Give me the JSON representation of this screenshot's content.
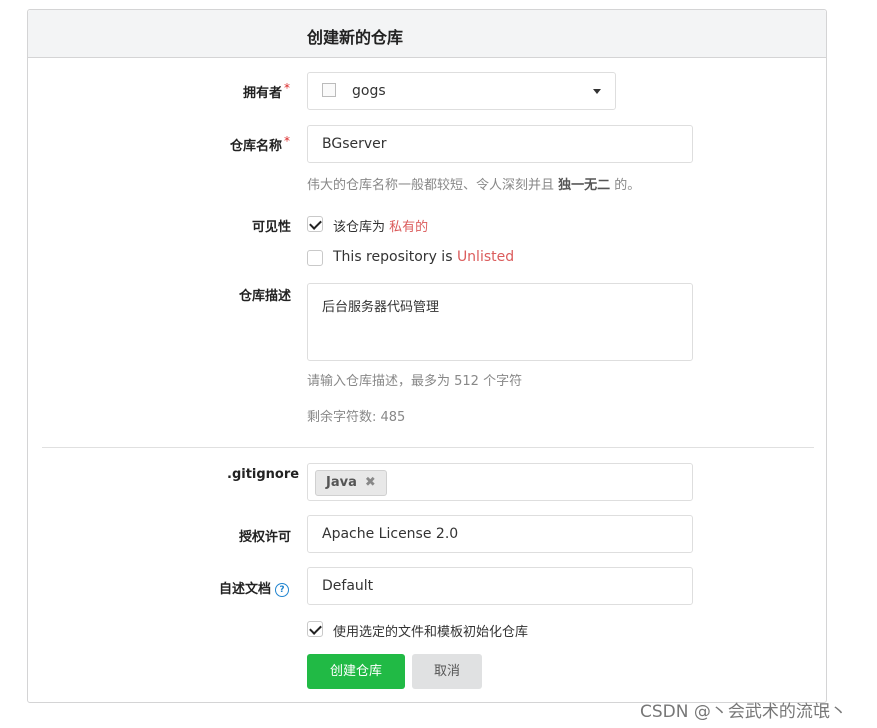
{
  "header": {
    "title": "创建新的仓库"
  },
  "owner": {
    "label": "拥有者",
    "required_mark": "*",
    "value": "gogs",
    "avatar_icon": "broken-image-icon"
  },
  "repo_name": {
    "label": "仓库名称",
    "required_mark": "*",
    "value": "BGserver",
    "help_prefix": "伟大的仓库名称一般都较短、令人深刻并且 ",
    "help_bold": "独一无二",
    "help_suffix": " 的。"
  },
  "visibility": {
    "label": "可见性",
    "private_prefix": "该仓库为 ",
    "private_highlight": "私有的",
    "private_checked": true,
    "unlisted_prefix": "This repository is ",
    "unlisted_highlight": "Unlisted",
    "unlisted_checked": false
  },
  "description": {
    "label": "仓库描述",
    "value": "后台服务器代码管理",
    "help": "请输入仓库描述，最多为 512 个字符",
    "remaining": "剩余字符数: 485"
  },
  "gitignore": {
    "label": ".gitignore",
    "tags": [
      "Java"
    ]
  },
  "license": {
    "label": "授权许可",
    "value": "Apache License 2.0"
  },
  "readme": {
    "label": "自述文档",
    "value": "Default",
    "help_icon": "question-circle-icon"
  },
  "auto_init": {
    "label": "使用选定的文件和模板初始化仓库",
    "checked": true
  },
  "actions": {
    "create_label": "创建仓库",
    "cancel_label": "取消"
  },
  "colors": {
    "primary_button": "#21ba45",
    "required": "#db2828",
    "highlight": "#db5c5c",
    "help_icon": "#2185d0"
  },
  "watermark": "CSDN @丶会武术的流氓丶"
}
